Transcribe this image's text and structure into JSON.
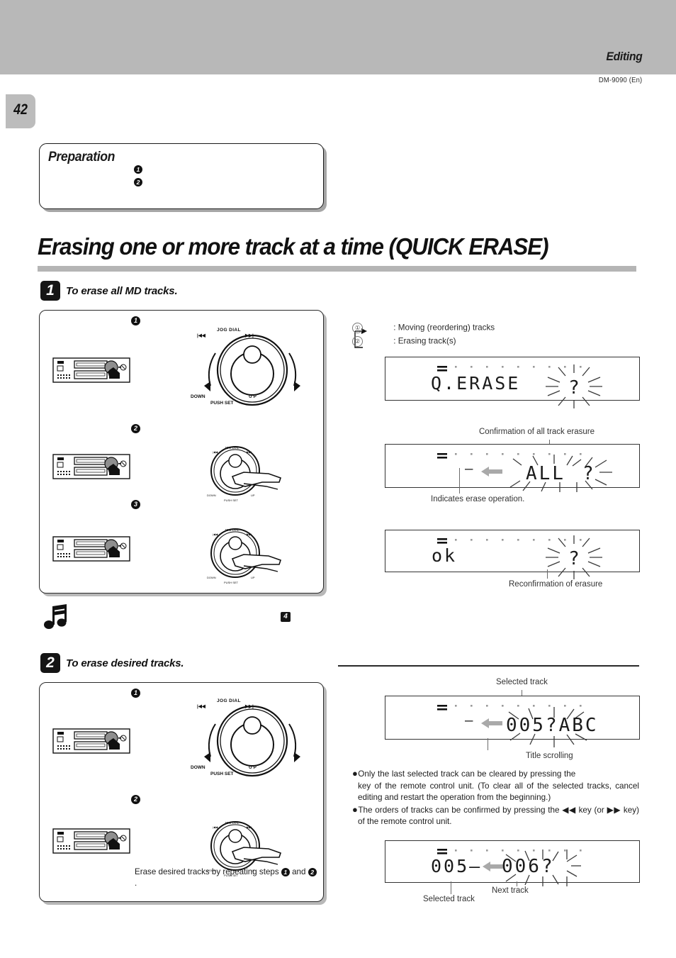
{
  "header": {
    "section_title": "Editing",
    "model_code": "DM-9090 (En)",
    "page_number": "42"
  },
  "preparation": {
    "title": "Preparation",
    "items": [
      {
        "num": "1",
        "text": ""
      },
      {
        "num": "2",
        "text": ""
      }
    ]
  },
  "main_heading": "Erasing one or more track at a time (QUICK ERASE)",
  "steps": [
    {
      "num": "1",
      "label": "To erase all MD tracks."
    },
    {
      "num": "2",
      "label": "To erase desired tracks."
    }
  ],
  "jog_dial": {
    "title": "JOG DIAL",
    "skip_back": "|◀◀",
    "skip_fwd": "▶▶|",
    "down": "DOWN",
    "up": "U P",
    "push_set": "PUSH SET"
  },
  "legend": {
    "rows": [
      {
        "num": "①",
        "text": ": Moving (reordering) tracks"
      },
      {
        "num": "②",
        "text": ": Erasing track(s)"
      }
    ]
  },
  "displays": [
    {
      "id": "display-q-erase",
      "text": "Q.ERASE",
      "flash": "?",
      "callout_top": "",
      "callout_bottom": ""
    },
    {
      "id": "display-all",
      "prefix": "—",
      "text": "ALL",
      "flash": "?",
      "callout_top": "Confirmation of all track erasure",
      "callout_bottom": "Indicates erase operation."
    },
    {
      "id": "display-ok",
      "text": "ok",
      "flash": "?",
      "callout_top": "",
      "callout_bottom": "Reconfirmation of erasure"
    },
    {
      "id": "display-005-abc",
      "prefix": "—",
      "text": "005?ABC",
      "callout_top": "Selected track",
      "callout_bottom": "Title scrolling"
    },
    {
      "id": "display-005-006",
      "text": "005—",
      "text2": "006?",
      "callout_bottom_left": "Selected track",
      "callout_bottom_right": "Next track"
    }
  ],
  "notes": {
    "bullet1_part1": "Only the last selected track can be cleared by pressing the",
    "bullet1_part2": "key of the remote control unit. (To clear all of the selected tracks, cancel editing and restart the operation from the beginning.)",
    "bullet2_part1": "The orders of tracks can be confirmed by pressing the",
    "bullet2_key1": "◀◀",
    "bullet2_part2": "key (or",
    "bullet2_key2": "▶▶",
    "bullet2_part3": "key) of the remote control unit."
  },
  "repeat_note": {
    "text_before": "Erase desired tracks by repeating steps",
    "num1": "1",
    "text_mid": "and",
    "num2": "2",
    "text_after": "."
  },
  "reference_chip": "4",
  "colors": {
    "header_band": "#b8b8b8",
    "rule": "#b5b5b5",
    "ink": "#1a1a1a",
    "arrow_gray": "#a9a9a9"
  }
}
